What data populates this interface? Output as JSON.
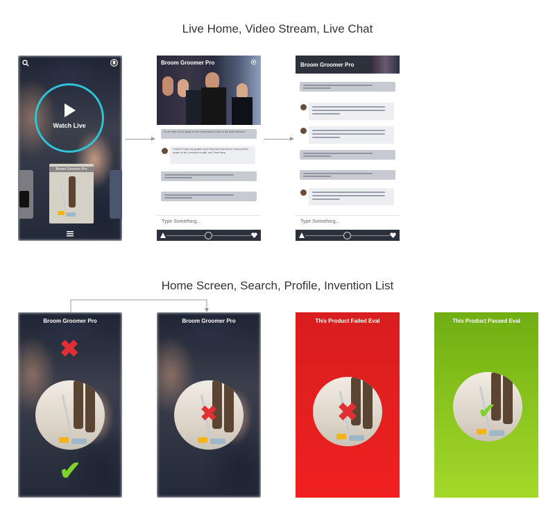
{
  "sections": {
    "top_title": "Live Home, Video Stream, Live Chat",
    "bottom_title": "Home Screen, Search, Profile, Invention List"
  },
  "screen1": {
    "watch_label": "Watch Live",
    "card_title": "Broom Groomer Pro",
    "icons": [
      "search-icon",
      "mic-icon",
      "play-icon",
      "menu-icon"
    ]
  },
  "screen2": {
    "header_title": "Broom Groomer Pro",
    "input_placeholder": "Type Something...",
    "question_text": "Do we have a final design for the conversations mode of the build interface?",
    "reply_text": "I haven't made any updates since they were last shown. It was just the avatar on left, comment on right, and I level deep."
  },
  "screen3": {
    "header_title": "Broom Groomer Pro",
    "input_placeholder": "Type Something..."
  },
  "screen4": {
    "title": "Broom Groomer Pro"
  },
  "screen5": {
    "title": "Broom Groomer Pro"
  },
  "screen6": {
    "title": "This Product Failed Eval",
    "bg_color": "#e31c1c"
  },
  "screen7": {
    "title": "This Product Passed Eval",
    "bg_color": "#8fcb1e"
  }
}
